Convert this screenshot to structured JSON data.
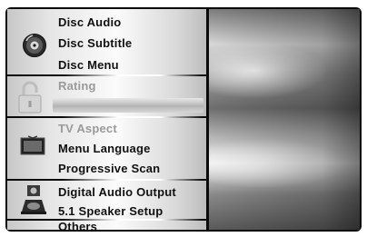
{
  "menu": {
    "disc": {
      "icon": "disc-icon",
      "items": [
        "Disc Audio",
        "Disc Subtitle",
        "Disc Menu"
      ]
    },
    "lock": {
      "icon": "lock-icon",
      "items": [
        "Rating"
      ]
    },
    "display": {
      "icon": "tv-icon",
      "items": [
        "TV Aspect",
        "Menu Language",
        "Progressive Scan"
      ]
    },
    "audio": {
      "icon": "speaker-icon",
      "items": [
        "Digital Audio Output",
        "5.1 Speaker Setup"
      ]
    },
    "others": {
      "items": [
        "Others"
      ]
    }
  },
  "colors": {
    "frame": "#0b0b0b",
    "text": "#111111",
    "faded_text": "#9a9a9a"
  }
}
